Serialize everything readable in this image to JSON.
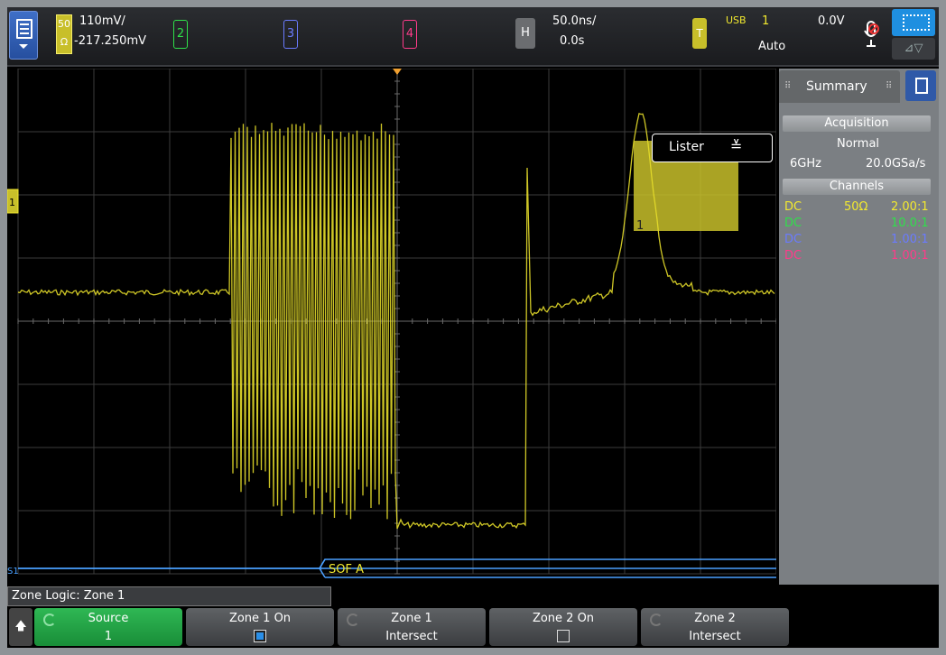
{
  "top_bar": {
    "ch1_coupling": "50",
    "ch1_unit": "Ω",
    "ch1_scale": "110mV/",
    "ch1_offset": "-217.250mV",
    "ch2_label": "2",
    "ch3_label": "3",
    "ch4_label": "4",
    "horiz_label": "H",
    "time_scale": "50.0ns/",
    "time_delay": "0.0s",
    "trig_label": "T",
    "trig_type": "USB",
    "trig_source": "1",
    "trig_level": "0.0V",
    "trig_mode": "Auto",
    "channel_colors": {
      "ch1": "#f2e92f",
      "ch2": "#2fe04a",
      "ch3": "#6a7bff",
      "ch4": "#ff3b8a"
    }
  },
  "display": {
    "lister_label": "Lister",
    "decode_text": "SOF A",
    "zone_label": "1",
    "bus_label": "S1"
  },
  "panel": {
    "tab_summary": "Summary",
    "acq_heading": "Acquisition",
    "acq_mode": "Normal",
    "bandwidth": "6GHz",
    "sample_rate": "20.0GSa/s",
    "channels_heading": "Channels",
    "channels": [
      {
        "coupling": "DC",
        "impedance": "50Ω",
        "probe": "2.00:1",
        "color": "#f2e92f"
      },
      {
        "coupling": "DC",
        "impedance": "",
        "probe": "10.0:1",
        "color": "#2fe04a"
      },
      {
        "coupling": "DC",
        "impedance": "",
        "probe": "1.00:1",
        "color": "#6a7bff"
      },
      {
        "coupling": "DC",
        "impedance": "",
        "probe": "1.00:1",
        "color": "#ff3b8a"
      }
    ]
  },
  "bottom": {
    "menu_title": "Zone Logic: Zone 1",
    "softkeys": [
      {
        "line1": "Source",
        "line2": "1"
      },
      {
        "line1": "Zone 1 On",
        "line2": ""
      },
      {
        "line1": "Zone 1",
        "line2": "Intersect"
      },
      {
        "line1": "Zone 2 On",
        "line2": ""
      },
      {
        "line1": "Zone 2",
        "line2": "Intersect"
      }
    ],
    "zone1_on": true,
    "zone2_on": false
  }
}
